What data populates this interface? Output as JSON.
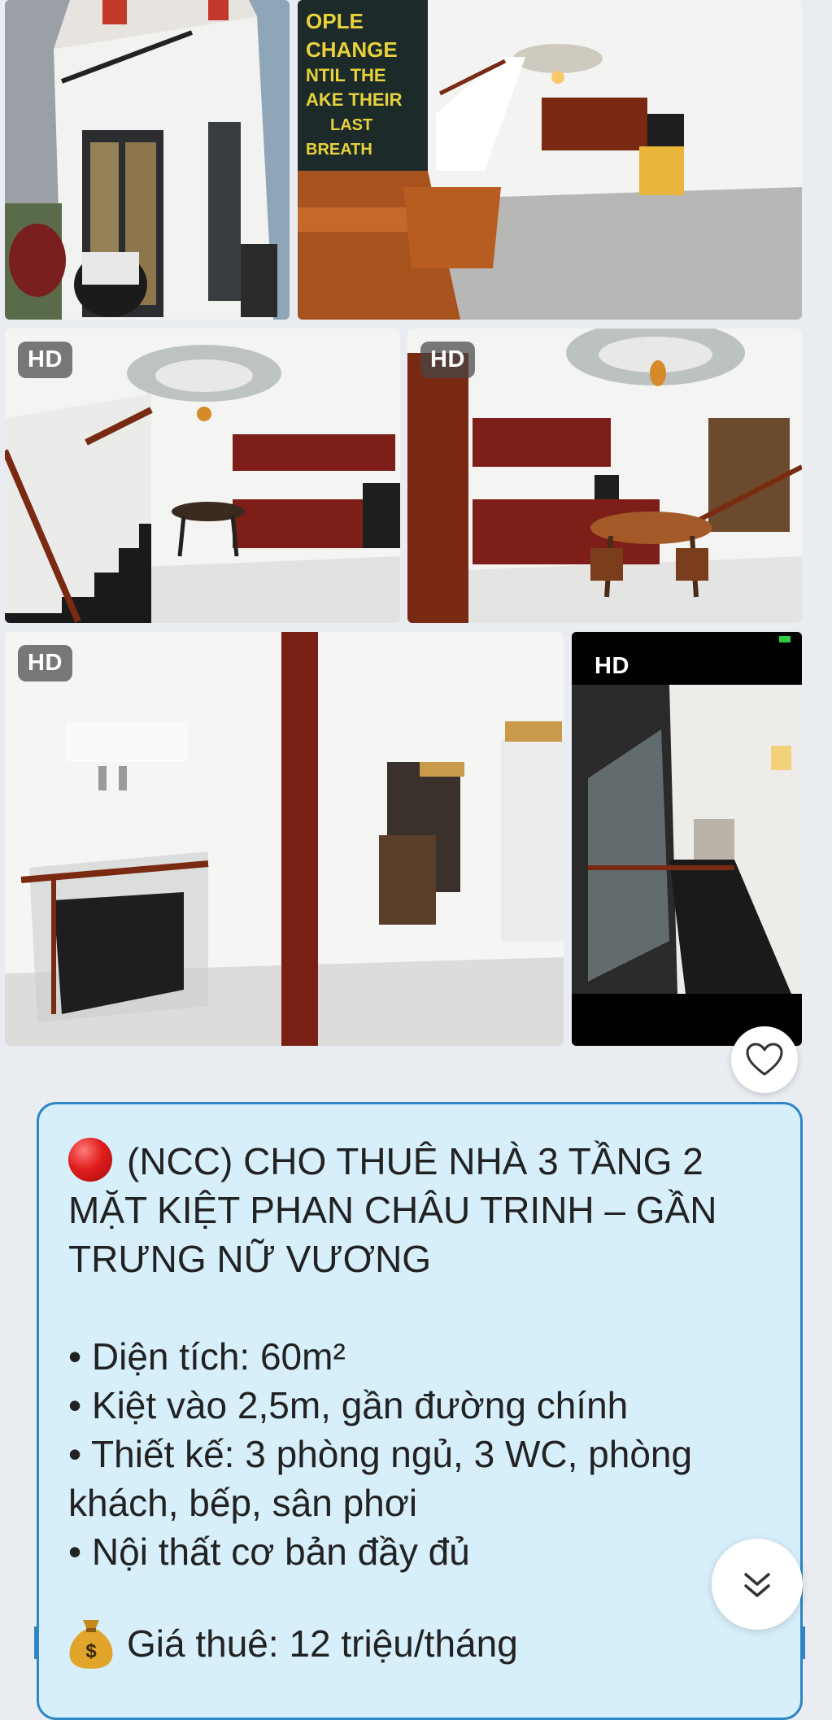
{
  "photos": [
    {
      "id": "photo-exterior",
      "badge": ""
    },
    {
      "id": "photo-living-room",
      "badge": ""
    },
    {
      "id": "photo-kitchen-stairs",
      "badge": "HD"
    },
    {
      "id": "photo-kitchen-dining",
      "badge": "HD"
    },
    {
      "id": "photo-upper-landing",
      "badge": "HD"
    },
    {
      "id": "photo-staircase",
      "badge": "HD"
    }
  ],
  "poster_text": [
    "OPLE",
    "CHANGE",
    "NTIL THE",
    "AKE THEIR",
    "LAST",
    "BREATH"
  ],
  "listing": {
    "title_lines": [
      "(NCC) CHO THUÊ NHÀ 3 TẦNG 2",
      "MẶT KIỆT PHAN CHÂU TRINH – GẦN",
      "TRƯNG NỮ VƯƠNG"
    ],
    "details": [
      "• Diện tích: 60m²",
      "• Kiệt vào 2,5m, gần đường chính",
      "• Thiết kế: 3 phòng ngủ, 3 WC, phòng",
      "khách, bếp, sân phơi",
      "• Nội thất cơ bản đầy đủ"
    ],
    "price": "Giá thuê: 12 triệu/tháng"
  },
  "icons": {
    "title_marker": "red-circle-icon",
    "favorite": "heart-icon",
    "scroll": "chevron-double-down-icon",
    "price_marker": "money-bag-icon"
  },
  "colors": {
    "card_background": "#d7effb",
    "card_border": "#2f86c6",
    "page_background": "#e9edf2"
  }
}
